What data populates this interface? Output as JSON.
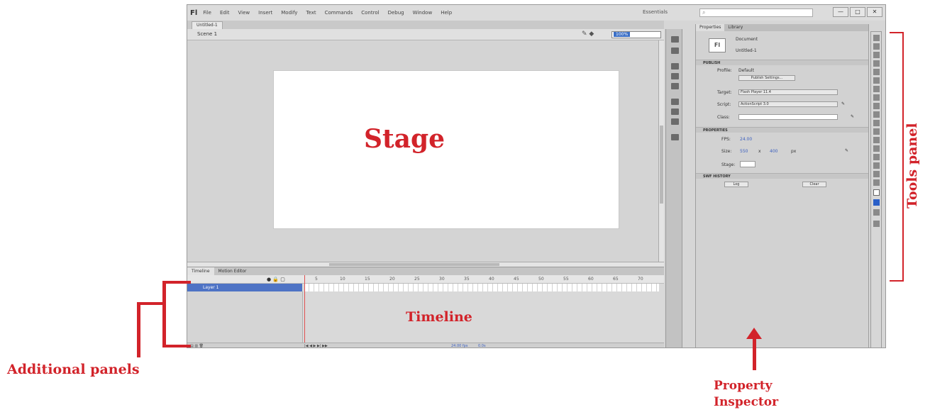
{
  "app": {
    "logo": "Fl",
    "menu": [
      "File",
      "Edit",
      "View",
      "Insert",
      "Modify",
      "Text",
      "Commands",
      "Control",
      "Debug",
      "Window",
      "Help"
    ],
    "workspace": "Essentials",
    "search_placeholder": "",
    "window_buttons": [
      "—",
      "□",
      "✕"
    ]
  },
  "document": {
    "tab_label": "Untitled-1",
    "scene_label": "Scene 1",
    "zoom": "100%"
  },
  "timeline": {
    "tabs": [
      "Timeline",
      "Motion Editor"
    ],
    "layer_name": "Layer 1",
    "ruler_marks": [
      "5",
      "10",
      "15",
      "20",
      "25",
      "30",
      "35",
      "40",
      "45",
      "50",
      "55",
      "60",
      "65",
      "70"
    ],
    "fps": "24.00 fps",
    "time": "0.0s"
  },
  "properties": {
    "tabs": [
      "Properties",
      "Library"
    ],
    "doc_icon_text": "Fl",
    "doc_type": "Document",
    "doc_name": "Untitled-1",
    "sections": {
      "publish": "PUBLISH",
      "properties": "PROPERTIES",
      "swf_history": "SWF HISTORY"
    },
    "profile_label": "Profile:",
    "profile_value": "Default",
    "publish_settings_btn": "Publish Settings...",
    "target_label": "Target:",
    "target_value": "Flash Player 11.4",
    "script_label": "Script:",
    "script_value": "ActionScript 3.0",
    "class_label": "Class:",
    "fps_label": "FPS:",
    "fps_value": "24.00",
    "size_label": "Size:",
    "size_w": "550",
    "size_x": "x",
    "size_h": "400",
    "size_unit": "px",
    "stage_label": "Stage:",
    "log_btn": "Log",
    "clear_btn": "Clear"
  },
  "annotations": {
    "stage": "Stage",
    "timeline": "Timeline",
    "additional_panels": "Additional panels",
    "property_inspector_line1": "Property",
    "property_inspector_line2": "Inspector",
    "tools_panel": "Tools panel"
  },
  "colors": {
    "annotation": "#d2232a",
    "layer_selected": "#4e73c5",
    "app_gray": "#d6d6d6"
  }
}
